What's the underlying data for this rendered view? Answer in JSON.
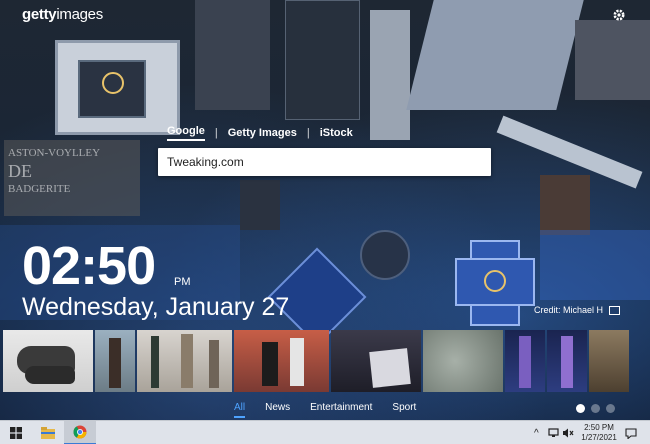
{
  "brand": {
    "logo_text": "gettyimages"
  },
  "search_tabs": [
    {
      "label": "Google",
      "active": true
    },
    {
      "label": "Getty Images",
      "active": false
    },
    {
      "label": "iStock",
      "active": false
    }
  ],
  "search": {
    "value": "Tweaking.com"
  },
  "watermark": {
    "lines": [
      "ASTON-VOYLLEY",
      "DE",
      "BADGERITE"
    ]
  },
  "clock": {
    "time": "02:50",
    "ampm": "PM",
    "date": "Wednesday, January 27"
  },
  "credit": {
    "label": "Credit: Michael H"
  },
  "categories": [
    {
      "label": "All",
      "active": true
    },
    {
      "label": "News",
      "active": false
    },
    {
      "label": "Entertainment",
      "active": false
    },
    {
      "label": "Sport",
      "active": false
    }
  ],
  "pager": {
    "count": 3,
    "active_index": 0
  },
  "taskbar": {
    "time": "2:50 PM",
    "date": "1/27/2021",
    "icons": [
      "windows-start-icon",
      "file-explorer-icon",
      "chrome-icon"
    ]
  },
  "colors": {
    "accent": "#4ea3ff",
    "taskbar_bg": "#dfe3ea"
  }
}
